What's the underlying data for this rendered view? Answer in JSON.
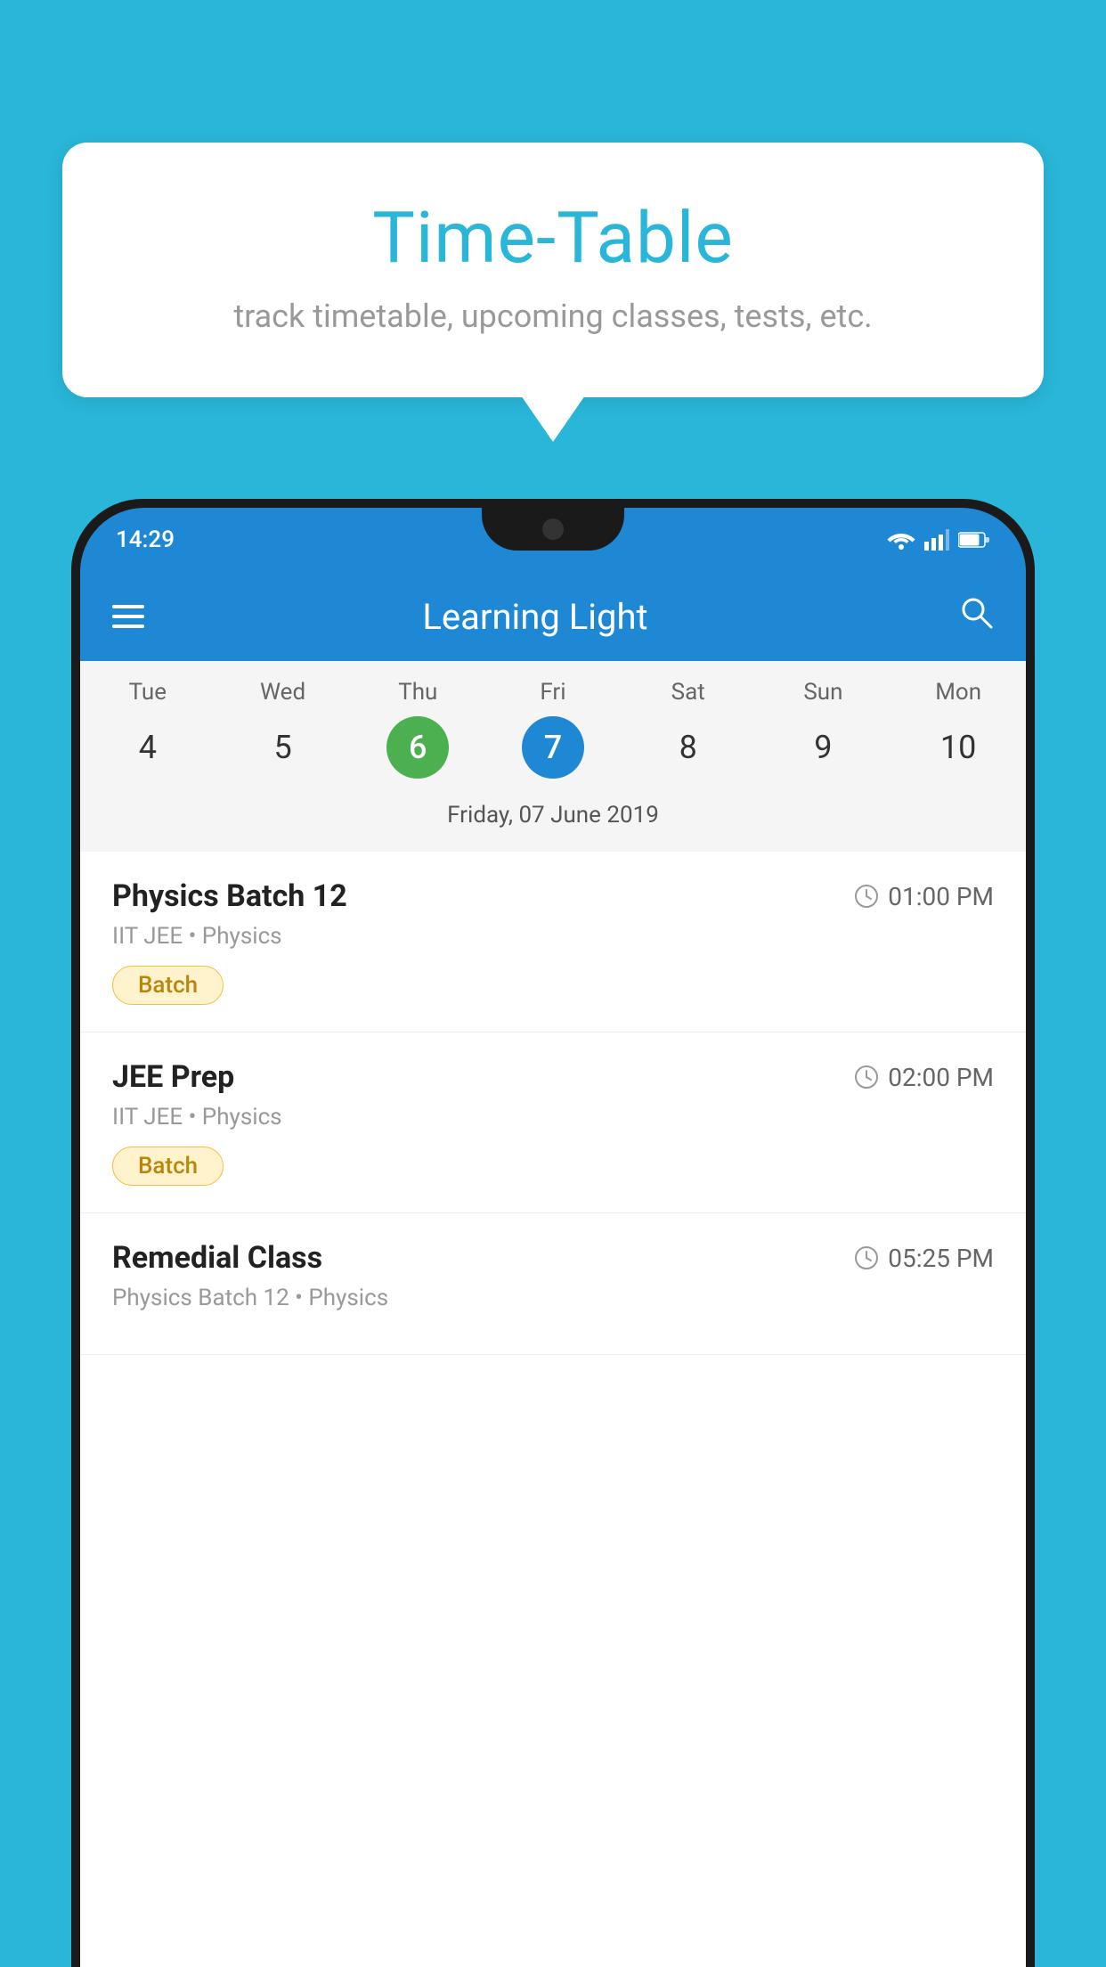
{
  "background_color": "#29B6D8",
  "bubble": {
    "title": "Time-Table",
    "subtitle": "track timetable, upcoming classes, tests, etc."
  },
  "status_bar": {
    "time": "14:29",
    "icons": [
      "wifi",
      "signal",
      "battery"
    ]
  },
  "app_bar": {
    "title": "Learning Light",
    "menu_icon": "hamburger",
    "search_icon": "search"
  },
  "calendar": {
    "days": [
      {
        "label": "Tue",
        "number": "4"
      },
      {
        "label": "Wed",
        "number": "5"
      },
      {
        "label": "Thu",
        "number": "6",
        "state": "today"
      },
      {
        "label": "Fri",
        "number": "7",
        "state": "selected"
      },
      {
        "label": "Sat",
        "number": "8"
      },
      {
        "label": "Sun",
        "number": "9"
      },
      {
        "label": "Mon",
        "number": "10"
      }
    ],
    "selected_date_label": "Friday, 07 June 2019"
  },
  "classes": [
    {
      "name": "Physics Batch 12",
      "time": "01:00 PM",
      "meta": "IIT JEE • Physics",
      "badge": "Batch"
    },
    {
      "name": "JEE Prep",
      "time": "02:00 PM",
      "meta": "IIT JEE • Physics",
      "badge": "Batch"
    },
    {
      "name": "Remedial Class",
      "time": "05:25 PM",
      "meta": "Physics Batch 12 • Physics",
      "badge": ""
    }
  ]
}
